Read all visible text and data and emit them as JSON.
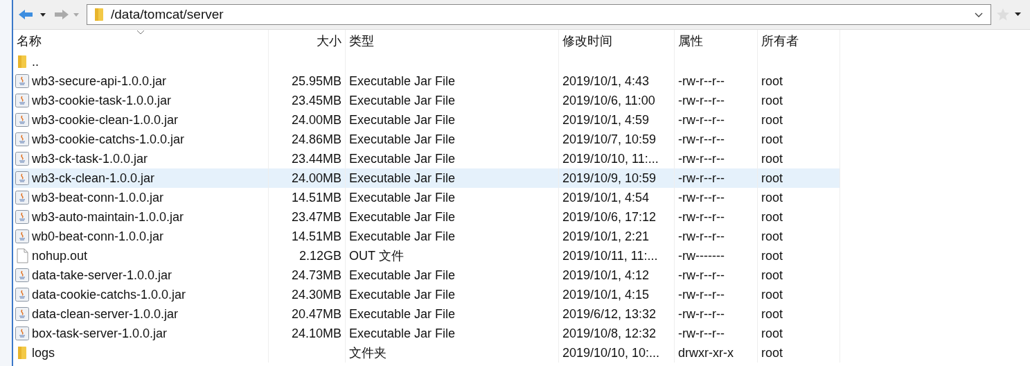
{
  "address_bar": {
    "path": "/data/tomcat/server"
  },
  "table": {
    "columns": [
      "名称",
      "大小",
      "类型",
      "修改时间",
      "属性",
      "所有者"
    ],
    "rows": [
      {
        "kind": "folder",
        "name": "..",
        "selected": false
      },
      {
        "kind": "jar",
        "name": "wb3-secure-api-1.0.0.jar",
        "size": "25.95MB",
        "type": "Executable Jar File",
        "modified": "2019/10/1, 4:43",
        "permissions": "-rw-r--r--",
        "owner": "root",
        "selected": false
      },
      {
        "kind": "jar",
        "name": "wb3-cookie-task-1.0.0.jar",
        "size": "23.45MB",
        "type": "Executable Jar File",
        "modified": "2019/10/6, 11:00",
        "permissions": "-rw-r--r--",
        "owner": "root",
        "selected": false
      },
      {
        "kind": "jar",
        "name": "wb3-cookie-clean-1.0.0.jar",
        "size": "24.00MB",
        "type": "Executable Jar File",
        "modified": "2019/10/1, 4:59",
        "permissions": "-rw-r--r--",
        "owner": "root",
        "selected": false
      },
      {
        "kind": "jar",
        "name": "wb3-cookie-catchs-1.0.0.jar",
        "size": "24.86MB",
        "type": "Executable Jar File",
        "modified": "2019/10/7, 10:59",
        "permissions": "-rw-r--r--",
        "owner": "root",
        "selected": false
      },
      {
        "kind": "jar",
        "name": "wb3-ck-task-1.0.0.jar",
        "size": "23.44MB",
        "type": "Executable Jar File",
        "modified": "2019/10/10, 11:...",
        "permissions": "-rw-r--r--",
        "owner": "root",
        "selected": false
      },
      {
        "kind": "jar",
        "name": "wb3-ck-clean-1.0.0.jar",
        "size": "24.00MB",
        "type": "Executable Jar File",
        "modified": "2019/10/9, 10:59",
        "permissions": "-rw-r--r--",
        "owner": "root",
        "selected": true
      },
      {
        "kind": "jar",
        "name": "wb3-beat-conn-1.0.0.jar",
        "size": "14.51MB",
        "type": "Executable Jar File",
        "modified": "2019/10/1, 4:54",
        "permissions": "-rw-r--r--",
        "owner": "root",
        "selected": false
      },
      {
        "kind": "jar",
        "name": "wb3-auto-maintain-1.0.0.jar",
        "size": "23.47MB",
        "type": "Executable Jar File",
        "modified": "2019/10/6, 17:12",
        "permissions": "-rw-r--r--",
        "owner": "root",
        "selected": false
      },
      {
        "kind": "jar",
        "name": "wb0-beat-conn-1.0.0.jar",
        "size": "14.51MB",
        "type": "Executable Jar File",
        "modified": "2019/10/1, 2:21",
        "permissions": "-rw-r--r--",
        "owner": "root",
        "selected": false
      },
      {
        "kind": "file",
        "name": "nohup.out",
        "size": "2.12GB",
        "type": "OUT 文件",
        "modified": "2019/10/11, 11:...",
        "permissions": "-rw-------",
        "owner": "root",
        "selected": false
      },
      {
        "kind": "jar",
        "name": "data-take-server-1.0.0.jar",
        "size": "24.73MB",
        "type": "Executable Jar File",
        "modified": "2019/10/1, 4:12",
        "permissions": "-rw-r--r--",
        "owner": "root",
        "selected": false
      },
      {
        "kind": "jar",
        "name": "data-cookie-catchs-1.0.0.jar",
        "size": "24.30MB",
        "type": "Executable Jar File",
        "modified": "2019/10/1, 4:15",
        "permissions": "-rw-r--r--",
        "owner": "root",
        "selected": false
      },
      {
        "kind": "jar",
        "name": "data-clean-server-1.0.0.jar",
        "size": "20.47MB",
        "type": "Executable Jar File",
        "modified": "2019/6/12, 13:32",
        "permissions": "-rw-r--r--",
        "owner": "root",
        "selected": false
      },
      {
        "kind": "jar",
        "name": "box-task-server-1.0.0.jar",
        "size": "24.10MB",
        "type": "Executable Jar File",
        "modified": "2019/10/8, 12:32",
        "permissions": "-rw-r--r--",
        "owner": "root",
        "selected": false
      },
      {
        "kind": "folder",
        "name": "logs",
        "type": "文件夹",
        "modified": "2019/10/10, 10:...",
        "permissions": "drwxr-xr-x",
        "owner": "root",
        "selected": false
      }
    ]
  }
}
